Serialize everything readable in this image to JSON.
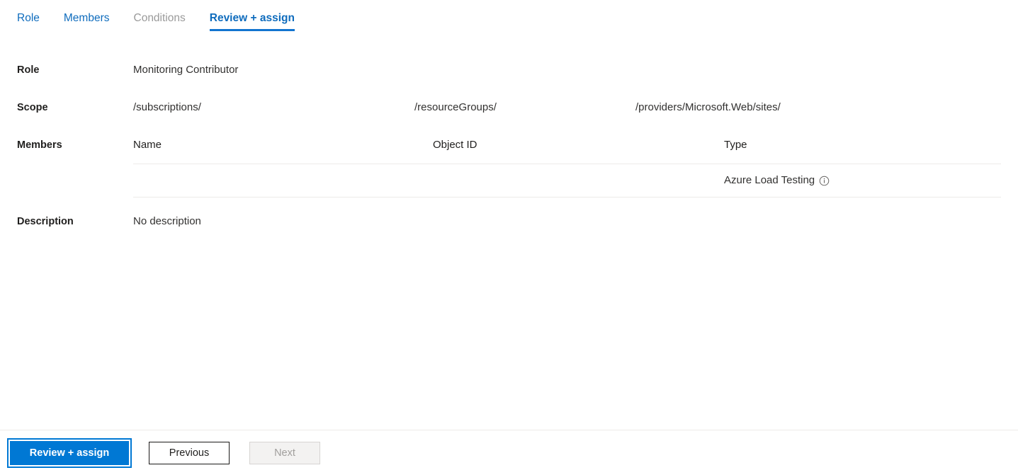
{
  "tabs": [
    {
      "label": "Role",
      "state": "link"
    },
    {
      "label": "Members",
      "state": "link"
    },
    {
      "label": "Conditions",
      "state": "disabled"
    },
    {
      "label": "Review + assign",
      "state": "active"
    }
  ],
  "fields": {
    "role": {
      "label": "Role",
      "value": "Monitoring Contributor"
    },
    "scope": {
      "label": "Scope",
      "segments": [
        "/subscriptions/",
        "/resourceGroups/",
        "/providers/Microsoft.Web/sites/"
      ]
    },
    "members": {
      "label": "Members"
    },
    "description": {
      "label": "Description",
      "value": "No description"
    }
  },
  "members_table": {
    "columns": [
      "Name",
      "Object ID",
      "Type"
    ],
    "rows": [
      {
        "name": "",
        "object_id": "",
        "type": "Azure Load Testing",
        "info_icon": "info-circle-icon"
      }
    ]
  },
  "footer": {
    "primary_label": "Review + assign",
    "previous_label": "Previous",
    "next_label": "Next"
  },
  "colors": {
    "accent_blue": "#0078d4",
    "tab_link_blue": "#0f6cbd",
    "tab_underline": "#1274cf",
    "disabled_text": "#a19f9d",
    "divider": "#edebe9"
  }
}
